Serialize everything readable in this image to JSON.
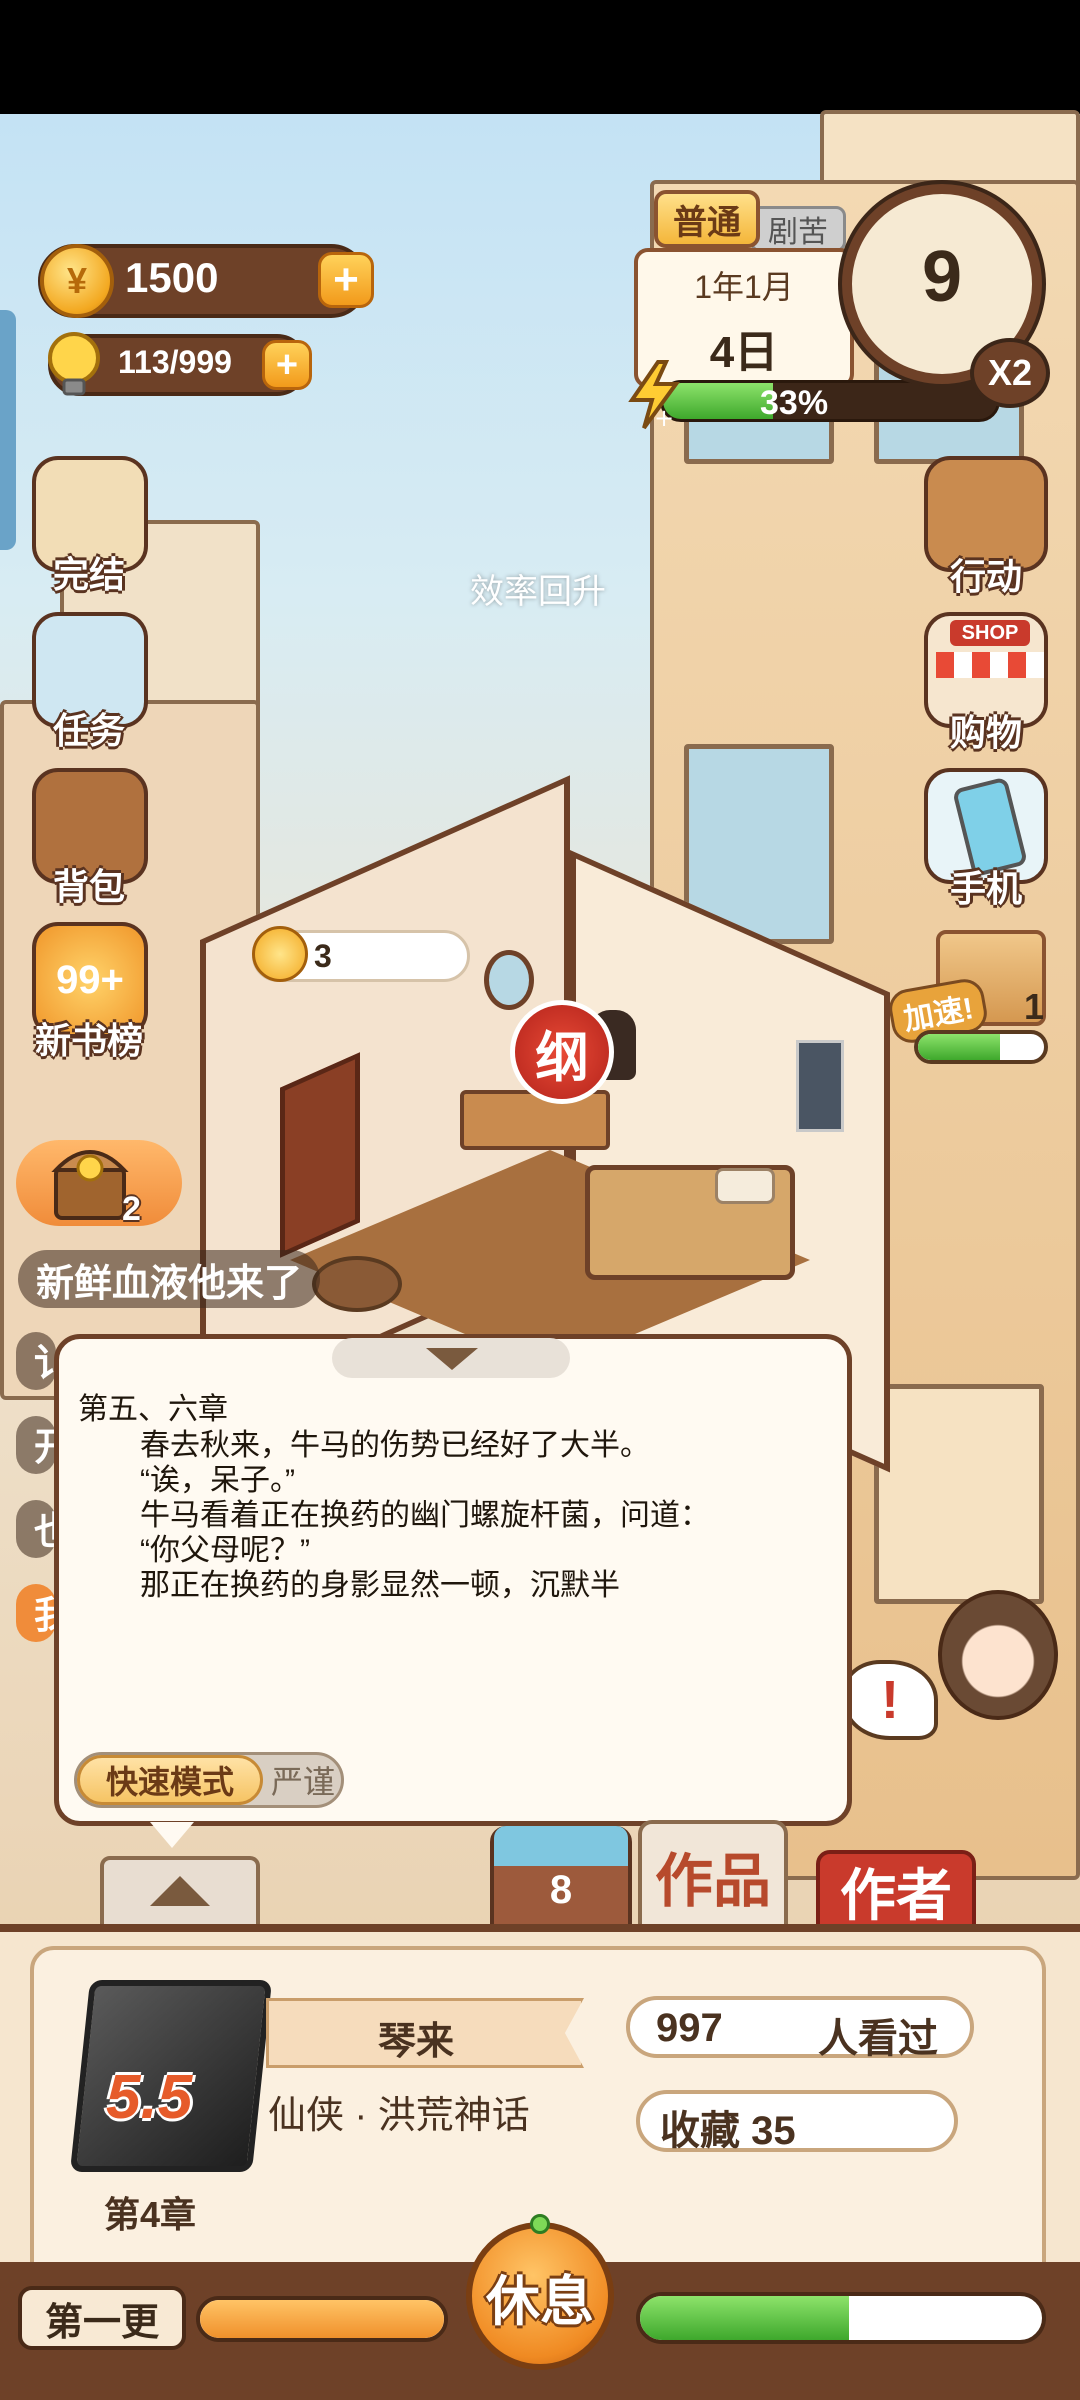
{
  "currency": {
    "coins": "1500",
    "inspiration": "113/999",
    "plus": "+"
  },
  "date_panel": {
    "mode_active": "普通",
    "mode_inactive": "剧苦",
    "month": "1年1月",
    "day": "4日",
    "energy_percent_label": "33%",
    "energy_fraction": 0.33,
    "clock_value": "9",
    "speed": "X2"
  },
  "left_menu": {
    "finish": "完结",
    "tasks": "任务",
    "bag": "背包",
    "ranking": "新书榜",
    "ranking_badge": "99+"
  },
  "right_menu": {
    "action": "行动",
    "shop": "购物",
    "shop_sign": "SHOP",
    "phone": "手机",
    "speedup_tag": "加速!",
    "speedup_count": "1",
    "speedup_fraction": 0.65
  },
  "scene": {
    "float_text": "效率回升",
    "coin_bubble_value": "3",
    "outline_seal": "纲",
    "chest_count": "2",
    "ticker": "新鲜血液他来了",
    "ticker_fragments": [
      "讠",
      "开",
      "也",
      "我"
    ]
  },
  "story": {
    "title": "第五、六章",
    "lines": [
      "春去秋来，牛马的伤势已经好了大半。",
      "“诶，呆子。”",
      "牛马看着正在换药的幽门螺旋杆菌，问道：",
      "“你父母呢？”",
      "那正在换药的身影显然一顿，沉默半"
    ],
    "mode_fast": "快速模式",
    "mode_strict": "严谨"
  },
  "tabs": {
    "count": "8",
    "works": "作品",
    "author": "作者"
  },
  "book": {
    "score": "5.5",
    "chapter": "第4章",
    "title": "琴来",
    "genre": "仙侠 · 洪荒神话",
    "views": "997",
    "views_label": "人看过",
    "favorites": "收藏 35"
  },
  "bottom": {
    "first_update": "第一更",
    "rest": "休息",
    "orange_fraction": 1.0,
    "green_fraction": 0.52
  }
}
